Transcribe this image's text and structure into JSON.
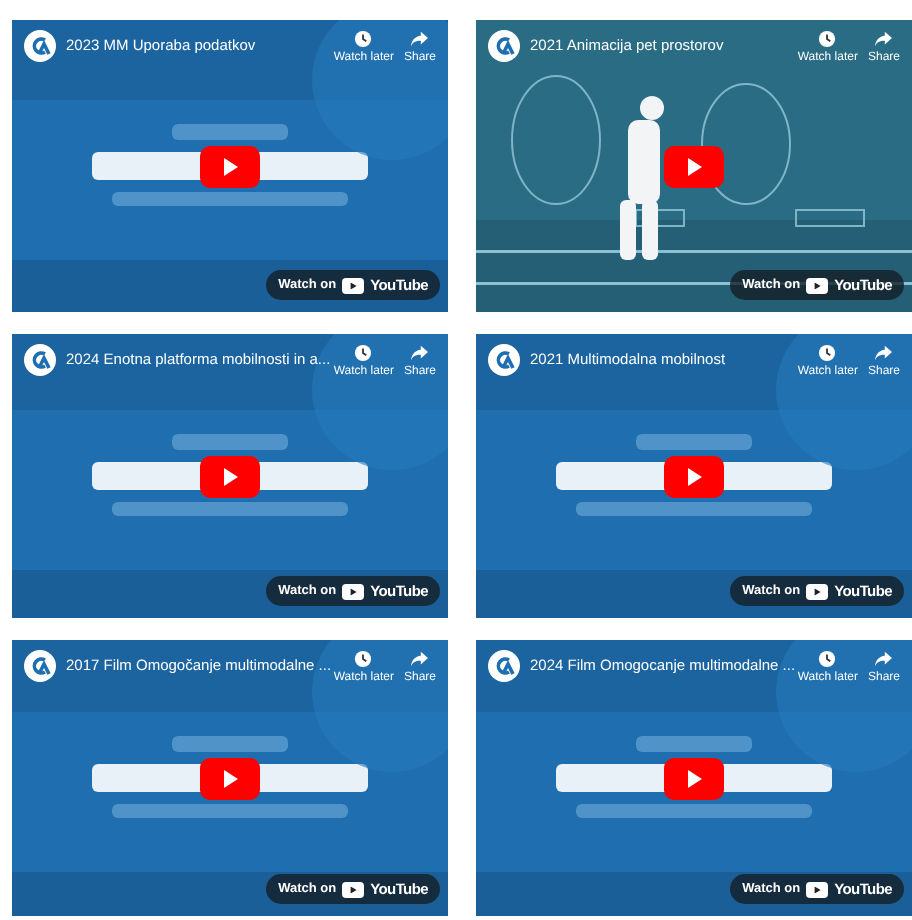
{
  "videos": [
    {
      "title": "2023 MM Uporaba podatkov",
      "kind": "title-card",
      "watch_later": "Watch later",
      "share": "Share",
      "watch_on": "Watch on",
      "logo": "YouTube"
    },
    {
      "title": "2021 Animacija pet prostorov",
      "kind": "park-animation",
      "watch_later": "Watch later",
      "share": "Share",
      "watch_on": "Watch on",
      "logo": "YouTube"
    },
    {
      "title": "2024 Enotna platforma mobilnosti in a...",
      "kind": "title-card",
      "watch_later": "Watch later",
      "share": "Share",
      "watch_on": "Watch on",
      "logo": "YouTube"
    },
    {
      "title": "2021 Multimodalna mobilnost",
      "kind": "title-card",
      "watch_later": "Watch later",
      "share": "Share",
      "watch_on": "Watch on",
      "logo": "YouTube"
    },
    {
      "title": "2017 Film Omogočanje multimodalne ...",
      "kind": "title-card",
      "watch_later": "Watch later",
      "share": "Share",
      "watch_on": "Watch on",
      "logo": "YouTube"
    },
    {
      "title": "2024 Film Omogocanje multimodalne ...",
      "kind": "title-card",
      "watch_later": "Watch later",
      "share": "Share",
      "watch_on": "Watch on",
      "logo": "YouTube"
    }
  ]
}
